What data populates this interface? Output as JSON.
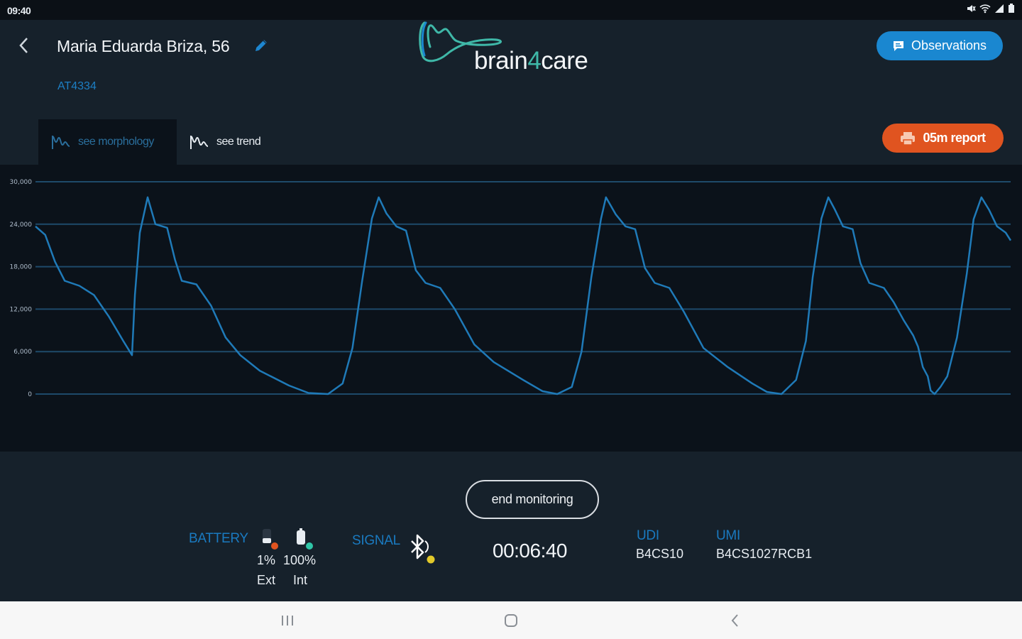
{
  "status_bar": {
    "time": "09:40"
  },
  "header": {
    "patient_name": "Maria Eduarda Briza, 56",
    "patient_id": "AT4334",
    "logo": {
      "text_before": "brain",
      "text_digit": "4",
      "text_after": "care"
    },
    "observations_label": "Observations"
  },
  "tabs": {
    "morphology_label": "see morphology",
    "trend_label": "see trend",
    "active": "morphology"
  },
  "report_label": "05m report",
  "colors": {
    "accent_blue": "#1a87d0",
    "report_orange": "#e05420",
    "waveform": "#1f7ab8",
    "logo_teal": "#3fb8a8"
  },
  "chart_data": {
    "type": "line",
    "title": "",
    "xlabel": "",
    "ylabel": "",
    "ylim": [
      0,
      30000
    ],
    "y_ticks": [
      "0",
      "6,000",
      "12,000",
      "18,000",
      "24,000",
      "30,000"
    ],
    "y_tick_values": [
      0,
      6000,
      12000,
      18000,
      24000,
      30000
    ],
    "grid": true,
    "xlim": [
      0,
      1000
    ],
    "series": [
      {
        "values": [
          [
            0,
            23700
          ],
          [
            10,
            22500
          ],
          [
            20,
            18700
          ],
          [
            30,
            16000
          ],
          [
            45,
            15300
          ],
          [
            60,
            14000
          ],
          [
            75,
            11000
          ],
          [
            90,
            7500
          ],
          [
            99,
            5500
          ],
          [
            102,
            14000
          ],
          [
            107,
            22800
          ],
          [
            115,
            27800
          ],
          [
            123,
            24000
          ],
          [
            135,
            23500
          ],
          [
            143,
            19000
          ],
          [
            150,
            16000
          ],
          [
            165,
            15500
          ],
          [
            180,
            12500
          ],
          [
            195,
            8000
          ],
          [
            210,
            5500
          ],
          [
            230,
            3300
          ],
          [
            260,
            1200
          ],
          [
            280,
            150
          ],
          [
            300,
            0
          ],
          [
            315,
            1500
          ],
          [
            325,
            6500
          ],
          [
            335,
            16000
          ],
          [
            345,
            24800
          ],
          [
            352,
            27800
          ],
          [
            360,
            25500
          ],
          [
            370,
            23700
          ],
          [
            380,
            23100
          ],
          [
            390,
            17500
          ],
          [
            400,
            15700
          ],
          [
            415,
            15000
          ],
          [
            430,
            12000
          ],
          [
            450,
            7000
          ],
          [
            470,
            4500
          ],
          [
            500,
            2000
          ],
          [
            520,
            400
          ],
          [
            535,
            0
          ],
          [
            550,
            1000
          ],
          [
            560,
            6000
          ],
          [
            570,
            16500
          ],
          [
            580,
            24800
          ],
          [
            585,
            27800
          ],
          [
            595,
            25400
          ],
          [
            605,
            23700
          ],
          [
            615,
            23300
          ],
          [
            625,
            17800
          ],
          [
            635,
            15700
          ],
          [
            650,
            15000
          ],
          [
            665,
            11600
          ],
          [
            685,
            6500
          ],
          [
            710,
            3800
          ],
          [
            735,
            1500
          ],
          [
            750,
            300
          ],
          [
            765,
            0
          ],
          [
            780,
            2000
          ],
          [
            790,
            7500
          ],
          [
            797,
            16500
          ],
          [
            806,
            24800
          ],
          [
            813,
            27800
          ],
          [
            820,
            26000
          ],
          [
            828,
            23700
          ],
          [
            838,
            23300
          ],
          [
            846,
            18500
          ],
          [
            855,
            15700
          ],
          [
            870,
            15000
          ],
          [
            880,
            13000
          ],
          [
            890,
            10500
          ],
          [
            900,
            8300
          ],
          [
            905,
            6700
          ],
          [
            910,
            3800
          ],
          [
            915,
            2500
          ],
          [
            918,
            500
          ],
          [
            922,
            0
          ],
          [
            928,
            1000
          ],
          [
            935,
            2500
          ],
          [
            945,
            8000
          ],
          [
            955,
            17000
          ],
          [
            962,
            24700
          ],
          [
            970,
            27800
          ],
          [
            978,
            26000
          ],
          [
            986,
            23700
          ],
          [
            995,
            22800
          ],
          [
            1000,
            21700
          ]
        ]
      }
    ]
  },
  "end_monitoring_label": "end monitoring",
  "battery": {
    "label": "BATTERY",
    "ext_percent": "1%",
    "int_percent": "100%",
    "ext_label": "Ext",
    "int_label": "Int"
  },
  "signal": {
    "label": "SIGNAL"
  },
  "timer": "00:06:40",
  "udi": {
    "label": "UDI",
    "value": "B4CS10"
  },
  "umi": {
    "label": "UMI",
    "value": "B4CS1027RCB1"
  }
}
